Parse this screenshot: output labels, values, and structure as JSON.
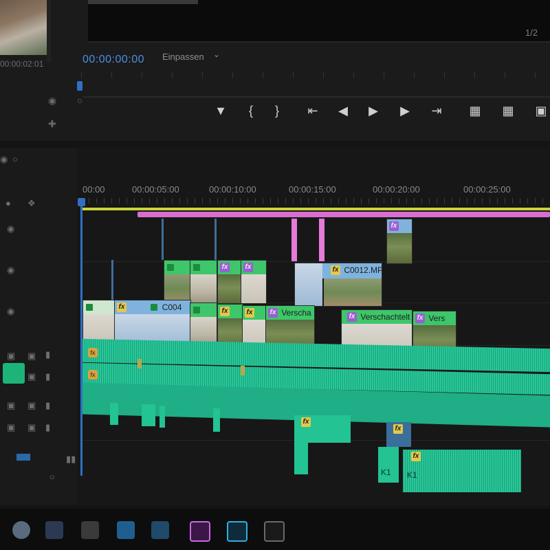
{
  "monitor": {
    "source_timecode": "00:00:02:01",
    "page_counter": "1/2",
    "playhead_timecode": "00:00:00:00",
    "fit_label": "Einpassen",
    "transport_icons": [
      "marker-icon",
      "mark-in-icon",
      "mark-out-icon",
      "go-to-in-icon",
      "step-back-icon",
      "play-icon",
      "step-forward-icon",
      "go-to-out-icon",
      "lift-icon",
      "extract-icon",
      "export-frame-icon"
    ]
  },
  "timeline": {
    "ruler_ticks": [
      "00:00",
      "00:00:05:00",
      "00:00:10:00",
      "00:00:15:00",
      "00:00:20:00",
      "00:00:25:00"
    ],
    "clips": {
      "c0012_label": "C0012.MP",
      "c004_label": "C004",
      "verschachtelt_1": "Verscha",
      "verschachtelt_2": "Verschachtelt",
      "verschachtelt_3": "Vers",
      "fx": "fx",
      "k1_a": "K1",
      "k1_b": "K1"
    },
    "colors": {
      "render_bar": "#c9d43a",
      "work_area": "#d86fd0",
      "playhead": "#2f6fc4",
      "audio": "#27c99a",
      "video_green_header": "#3ec66a",
      "video_blue_header": "#7fb3de"
    }
  }
}
